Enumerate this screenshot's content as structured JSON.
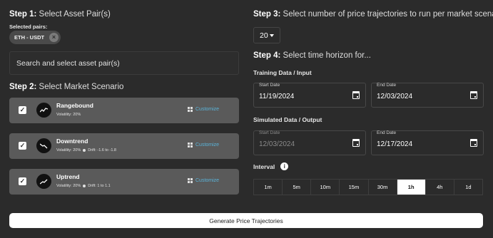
{
  "step1": {
    "num": "Step 1:",
    "text": "Select Asset Pair(s)",
    "selected_label": "Selected pairs:",
    "chip": "ETH - USDT",
    "search_placeholder": "Search and select asset pair(s)"
  },
  "step2": {
    "num": "Step 2:",
    "text": "Select Market Scenario"
  },
  "scenarios": [
    {
      "name": "Rangebound",
      "volatility": "Volatility: 20%",
      "drift": "",
      "customize": "Customize",
      "checked": true,
      "icon": "wave-trend-icon"
    },
    {
      "name": "Downtrend",
      "volatility": "Volatility: 20%",
      "drift": "Drift: -1.6 to -1.8",
      "customize": "Customize",
      "checked": true,
      "icon": "down-trend-icon"
    },
    {
      "name": "Uptrend",
      "volatility": "Volatility: 20%",
      "drift": "Drift: 1 to 1.1",
      "customize": "Customize",
      "checked": true,
      "icon": "up-trend-icon"
    }
  ],
  "step3": {
    "num": "Step 3:",
    "text": "Select number of price trajectories to run per market scenario",
    "value": "20"
  },
  "step4": {
    "num": "Step 4:",
    "text": "Select time horizon for..."
  },
  "training": {
    "title": "Training Data / Input",
    "start_label": "Start Date",
    "start": "11/19/2024",
    "end_label": "End Date",
    "end": "12/03/2024"
  },
  "simulated": {
    "title": "Simulated Data / Output",
    "start_label": "Start Date",
    "start": "12/03/2024",
    "end_label": "End Date",
    "end": "12/17/2024"
  },
  "interval": {
    "label": "Interval",
    "options": [
      "1m",
      "5m",
      "10m",
      "15m",
      "30m",
      "1h",
      "4h",
      "1d"
    ],
    "selected": "1h"
  },
  "generate_label": "Generate Price Trajectories",
  "colors": {
    "background": "#2b2b2b",
    "scenario_bg": "#5a5a5a",
    "customize": "#5ab3d8"
  }
}
